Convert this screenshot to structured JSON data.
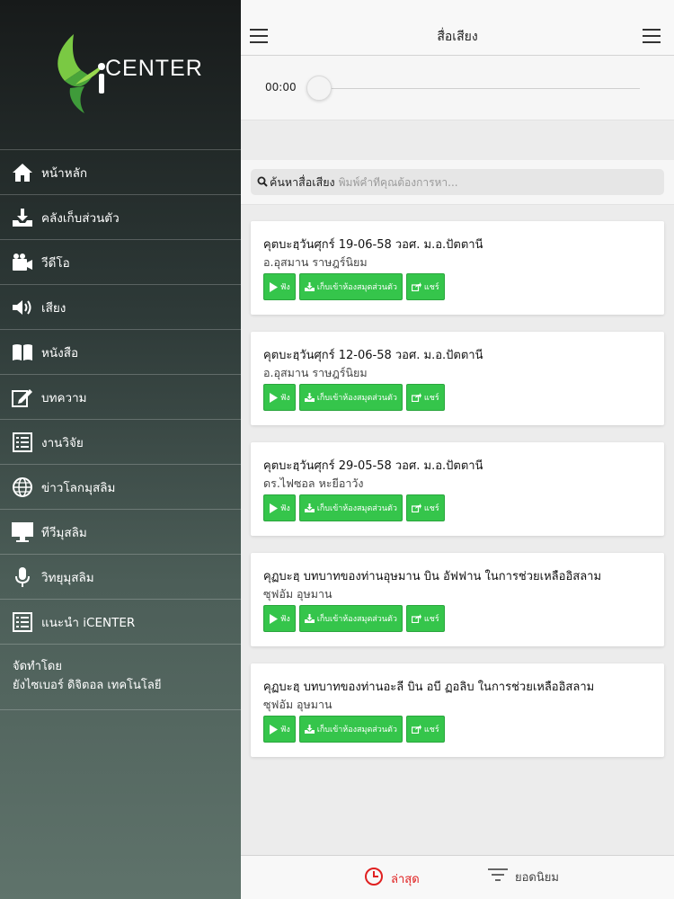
{
  "app": {
    "logo_text": "iCENTER",
    "colors": {
      "accent_green": "#35c54b",
      "active_red": "#e02020"
    }
  },
  "sidebar": {
    "items": [
      {
        "label": "หน้าหลัก",
        "icon": "home-icon"
      },
      {
        "label": "คลังเก็บส่วนตัว",
        "icon": "download-tray-icon"
      },
      {
        "label": "วีดีโอ",
        "icon": "video-camera-icon"
      },
      {
        "label": "เสียง",
        "icon": "speaker-icon"
      },
      {
        "label": "หนังสือ",
        "icon": "book-icon"
      },
      {
        "label": "บทความ",
        "icon": "edit-icon"
      },
      {
        "label": "งานวิจัย",
        "icon": "document-list-icon"
      },
      {
        "label": "ข่าวโลกมุสลิม",
        "icon": "globe-icon"
      },
      {
        "label": "ทีวีมุสลิม",
        "icon": "monitor-icon"
      },
      {
        "label": "วิทยุมุสลิม",
        "icon": "microphone-icon"
      },
      {
        "label": "แนะนำ iCENTER",
        "icon": "document-list-icon"
      }
    ],
    "credit_line1": "จัดทำโดย",
    "credit_line2": "ยังไซเบอร์ ดิจิตอล เทคโนโลยี"
  },
  "header": {
    "title": "สื่อเสียง"
  },
  "player": {
    "time": "00:00",
    "progress": 0
  },
  "search": {
    "label": "ค้นหาสื่อเสียง",
    "placeholder": "พิมพ์คำที่คุณต้องการหา..."
  },
  "buttons": {
    "listen": "ฟัง",
    "save": "เก็บเข้าห้องสมุดส่วนตัว",
    "share": "แชร์"
  },
  "items": [
    {
      "title": "คุตบะฮฺวันศุกร์ 19-06-58 วอศ. ม.อ.ปัตตานี",
      "author": "อ.อุสมาน ราษฎร์นิยม"
    },
    {
      "title": "คุตบะฮฺวันศุกร์ 12-06-58 วอศ. ม.อ.ปัตตานี",
      "author": "อ.อุสมาน ราษฎร์นิยม"
    },
    {
      "title": "คุตบะฮฺวันศุกร์ 29-05-58 วอศ. ม.อ.ปัตตานี",
      "author": "ดร.ไฟซอล หะยีอาวัง"
    },
    {
      "title": "คุฏบะฮฺ บทบาทของท่านอุษมาน บิน อัฟฟาน ในการช่วยเหลืออิสลาม",
      "author": "ซุฟอัม อุษมาน"
    },
    {
      "title": "คุฏบะฮฺ บทบาทของท่านอะลี บิน อบี ฏอลิบ ในการช่วยเหลืออิสลาม",
      "author": "ซุฟอัม อุษมาน"
    }
  ],
  "bottom_tabs": {
    "latest": "ล่าสุด",
    "popular": "ยอดนิยม"
  }
}
